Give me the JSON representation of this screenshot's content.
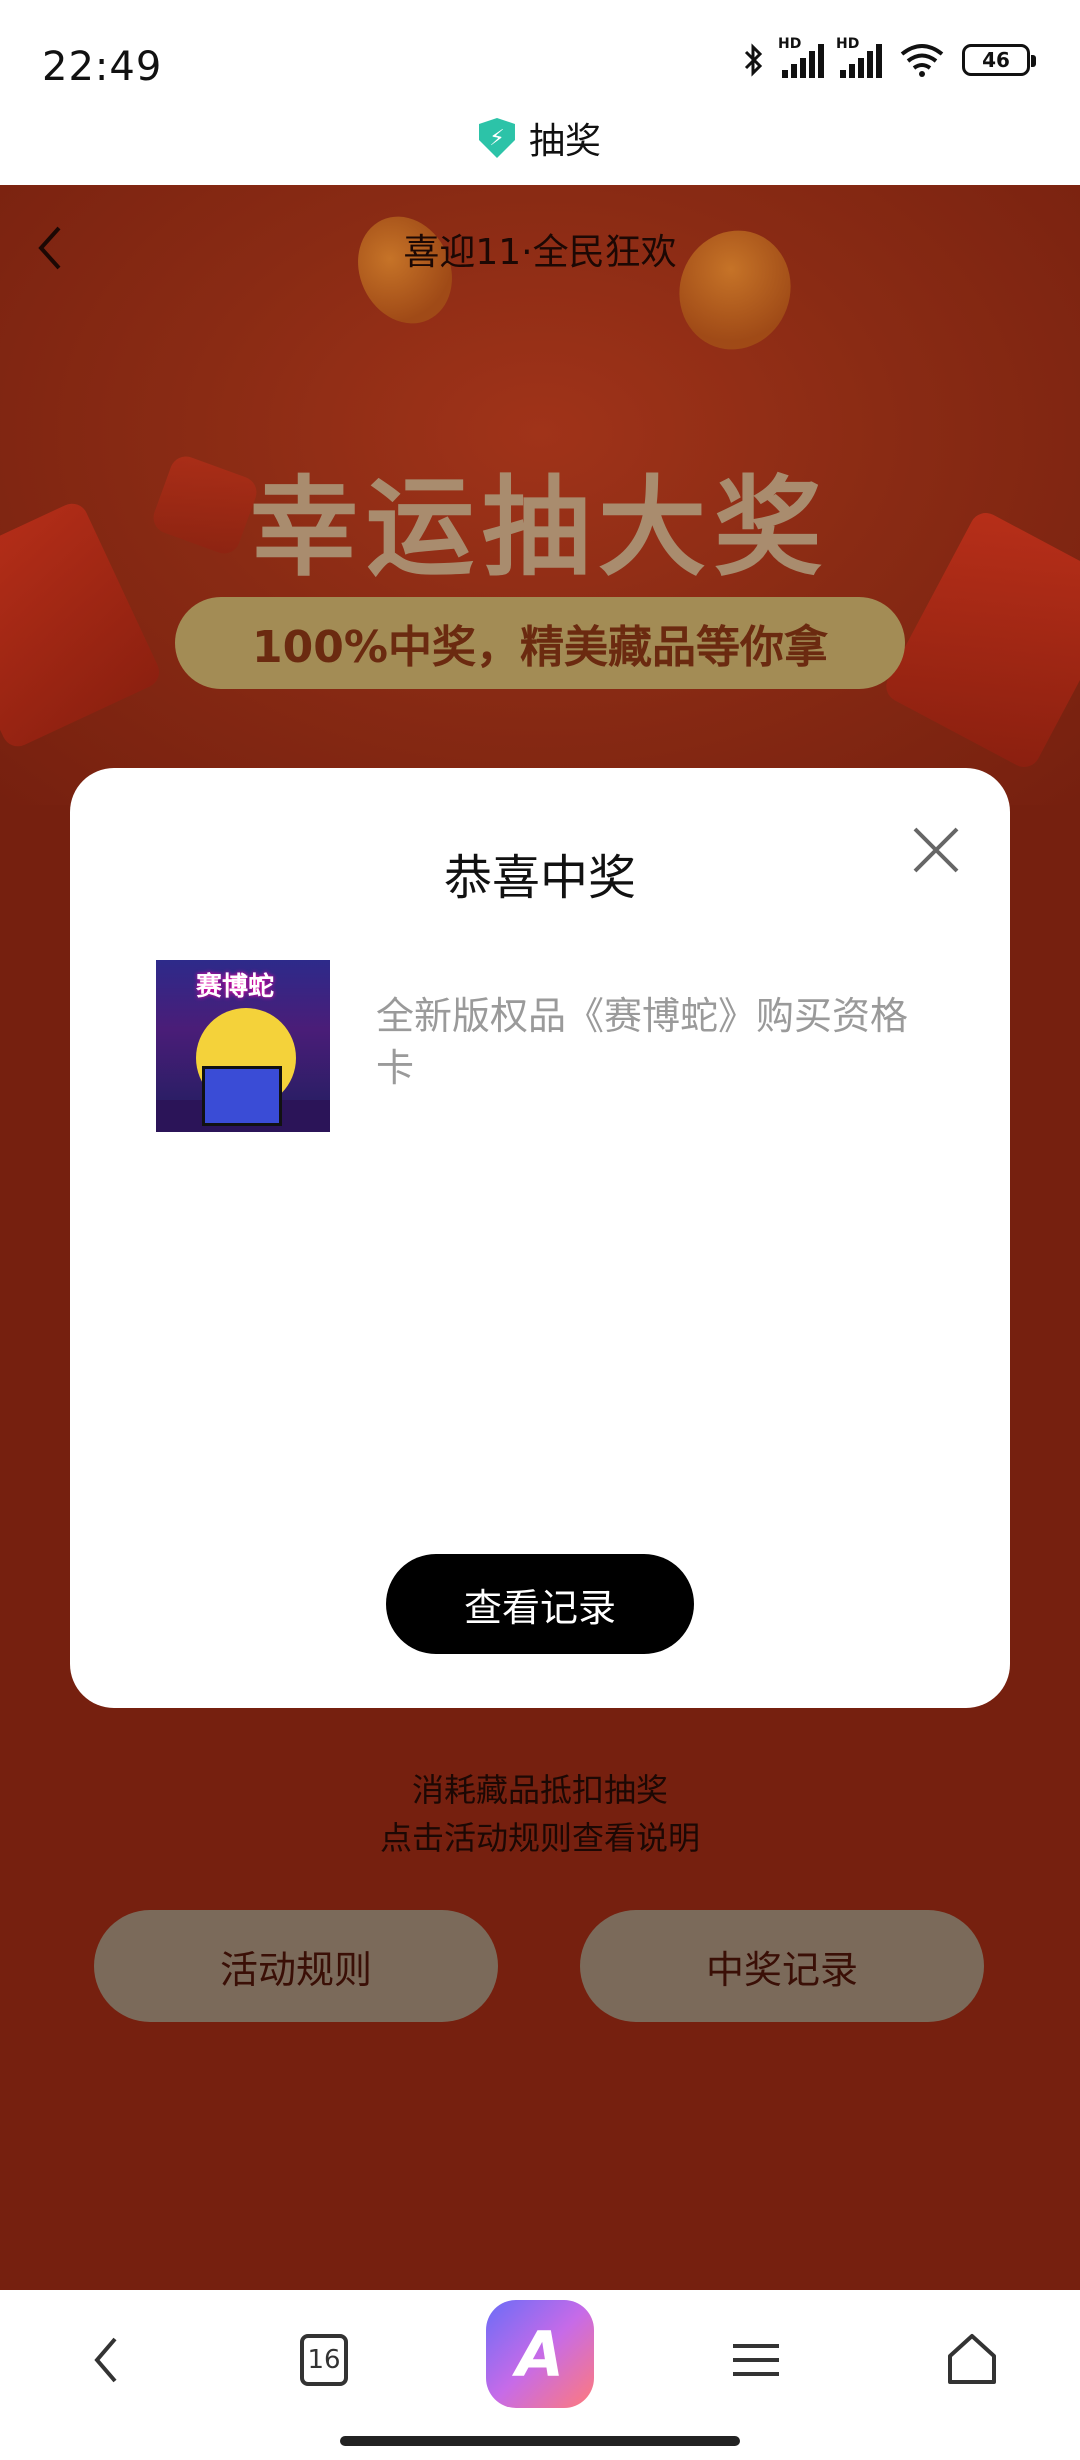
{
  "status_bar": {
    "time": "22:49",
    "battery": "46",
    "hd_label": "HD"
  },
  "site_header": {
    "title": "抽奖",
    "icon": "shield-bolt-icon"
  },
  "page": {
    "title": "喜迎11·全民狂欢",
    "back_icon": "chevron-left-icon",
    "headline": "幸运抽大奖",
    "tagline": "100%中奖，精美藏品等你拿",
    "hint_line1": "消耗藏品抵扣抽奖",
    "hint_line2": "点击活动规则查看说明",
    "rules_button": "活动规则",
    "records_button": "中奖记录",
    "colors": {
      "page_bg": "#76200f",
      "button_bg": "#7b6a5a",
      "tagline_bg": "#a38c55"
    }
  },
  "modal": {
    "title": "恭喜中奖",
    "close_icon": "close-icon",
    "prize_badge": "赛博蛇",
    "prize_name": "全新版权品《赛博蛇》购买资格卡",
    "view_record_button": "查看记录"
  },
  "bottom_nav": {
    "back_icon": "chevron-left-icon",
    "tabs_count": "16",
    "app_icon_label": "A",
    "menu_icon": "menu-icon",
    "home_icon": "home-icon"
  }
}
